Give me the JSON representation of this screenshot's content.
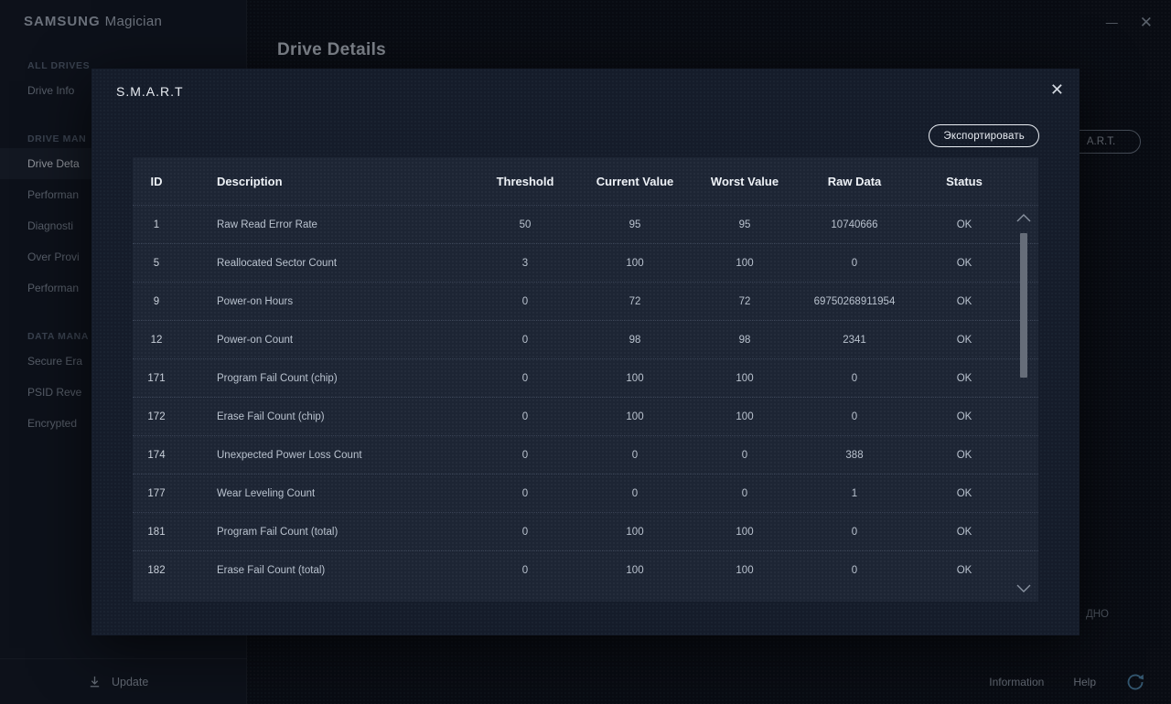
{
  "window": {
    "brand_bold": "SAMSUNG",
    "brand_light": "Magician",
    "minimize_icon": "—",
    "close_icon": "✕"
  },
  "sidebar": {
    "sections": [
      {
        "header": "ALL DRIVES",
        "items": [
          {
            "label": "Drive Info",
            "selected": false
          }
        ]
      },
      {
        "header": "DRIVE MAN",
        "items": [
          {
            "label": "Drive Deta",
            "selected": true
          },
          {
            "label": "Performan",
            "selected": false
          },
          {
            "label": "Diagnosti",
            "selected": false
          },
          {
            "label": "Over Provi",
            "selected": false
          },
          {
            "label": "Performan",
            "selected": false
          }
        ]
      },
      {
        "header": "DATA MANA",
        "items": [
          {
            "label": "Secure Era",
            "selected": false
          },
          {
            "label": "PSID Reve",
            "selected": false
          },
          {
            "label": "Encrypted",
            "selected": false
          }
        ]
      }
    ],
    "update_label": "Update"
  },
  "main": {
    "title": "Drive Details",
    "partial_button_label": "A.R.T.",
    "partial_bottom_label": "ДНО"
  },
  "footer": {
    "information_label": "Information",
    "help_label": "Help"
  },
  "modal": {
    "title": "S.M.A.R.T",
    "close_icon": "✕",
    "export_label": "Экспортировать",
    "table": {
      "columns": [
        "ID",
        "Description",
        "Threshold",
        "Current Value",
        "Worst Value",
        "Raw Data",
        "Status"
      ],
      "rows": [
        [
          "1",
          "Raw Read Error Rate",
          "50",
          "95",
          "95",
          "10740666",
          "OK"
        ],
        [
          "5",
          "Reallocated Sector Count",
          "3",
          "100",
          "100",
          "0",
          "OK"
        ],
        [
          "9",
          "Power-on Hours",
          "0",
          "72",
          "72",
          "69750268911954",
          "OK"
        ],
        [
          "12",
          "Power-on Count",
          "0",
          "98",
          "98",
          "2341",
          "OK"
        ],
        [
          "171",
          "Program Fail Count (chip)",
          "0",
          "100",
          "100",
          "0",
          "OK"
        ],
        [
          "172",
          "Erase Fail Count (chip)",
          "0",
          "100",
          "100",
          "0",
          "OK"
        ],
        [
          "174",
          "Unexpected Power Loss Count",
          "0",
          "0",
          "0",
          "388",
          "OK"
        ],
        [
          "177",
          "Wear Leveling Count",
          "0",
          "0",
          "0",
          "1",
          "OK"
        ],
        [
          "181",
          "Program Fail Count (total)",
          "0",
          "100",
          "100",
          "0",
          "OK"
        ],
        [
          "182",
          "Erase Fail Count (total)",
          "0",
          "100",
          "100",
          "0",
          "OK"
        ]
      ]
    }
  },
  "colors": {
    "page_bg": "#0c1017",
    "sidebar_bg": "#121722",
    "modal_bg": "#151c2a",
    "table_bg": "#1d2534",
    "text_bright": "#eef2f7",
    "text_body": "#b9c2ce",
    "refresh_accent": "#4f86ab"
  }
}
